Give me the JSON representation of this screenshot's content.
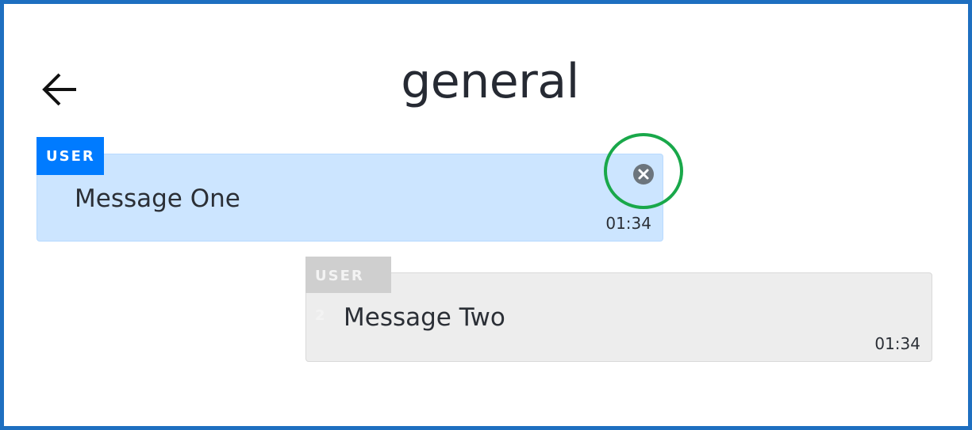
{
  "header": {
    "title": "general",
    "back_icon": "arrow-left-icon"
  },
  "messages": [
    {
      "user": "USER",
      "text": "Message One",
      "time": "01:34",
      "tag_color": "#007bff",
      "bubble_color": "#cce5ff",
      "close_icon": "close-circle-icon"
    },
    {
      "user": "USER 2",
      "text": "Message Two",
      "time": "01:34",
      "tag_color": "#cfcfcf",
      "bubble_color": "#ededed"
    }
  ],
  "annotation": {
    "highlight_color": "#19a84a"
  }
}
